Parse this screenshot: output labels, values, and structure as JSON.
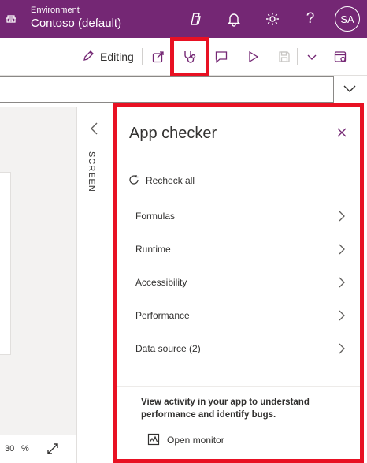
{
  "header": {
    "env_label": "Environment",
    "env_name": "Contoso (default)",
    "avatar_initials": "SA",
    "help_glyph": "?",
    "icons": [
      "environment-icon",
      "copilot-icon",
      "notifications-icon",
      "settings-icon",
      "help-icon"
    ],
    "background": "#742774"
  },
  "commandbar": {
    "editing_label": "Editing",
    "icons": [
      "pencil-icon",
      "share-icon",
      "app-checker-icon",
      "comments-icon",
      "play-icon",
      "save-icon",
      "chevron-down-icon",
      "publish-icon"
    ]
  },
  "canvas": {
    "zoom_value": "30",
    "zoom_unit": "%"
  },
  "screen_pane": {
    "label": "SCREEN"
  },
  "app_checker": {
    "title": "App checker",
    "recheck_label": "Recheck all",
    "items": [
      {
        "label": "Formulas"
      },
      {
        "label": "Runtime"
      },
      {
        "label": "Accessibility"
      },
      {
        "label": "Performance"
      },
      {
        "label": "Data source (2)"
      }
    ],
    "monitor_text": "View activity in your app to understand performance and identify bugs.",
    "monitor_link": "Open monitor"
  },
  "colors": {
    "brand": "#742774",
    "highlight": "#e81123",
    "accent_icon": "#742774"
  }
}
